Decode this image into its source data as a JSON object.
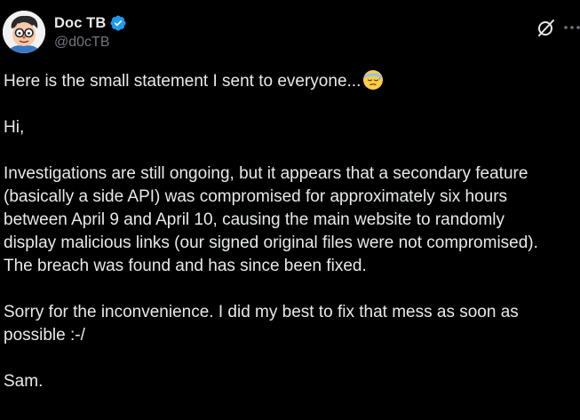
{
  "author": {
    "display_name": "Doc TB",
    "handle": "@d0cTB",
    "verified": true,
    "verified_color": "#1d9bf0"
  },
  "header_actions": {
    "grok_icon": "grok-icon",
    "more_icon": "more-icon"
  },
  "tweet": {
    "intro": "Here is the small statement I sent to everyone...",
    "intro_emoji": "downcast-face-with-sweat-emoji",
    "greeting": "Hi,",
    "body": "Investigations are still ongoing, but it appears that a secondary feature\n(basically a side API) was compromised for approximately six hours\nbetween April 9 and April 10, causing the main website to randomly\ndisplay malicious links (our signed original files were not compromised).\nThe breach was found and has since been fixed.",
    "apology": "Sorry for the inconvenience. I did my best to fix that mess as soon as\npossible :-/",
    "signoff": "Sam."
  },
  "colors": {
    "background": "#000000",
    "text": "#e7e9ea",
    "secondary_text": "#71767b"
  }
}
